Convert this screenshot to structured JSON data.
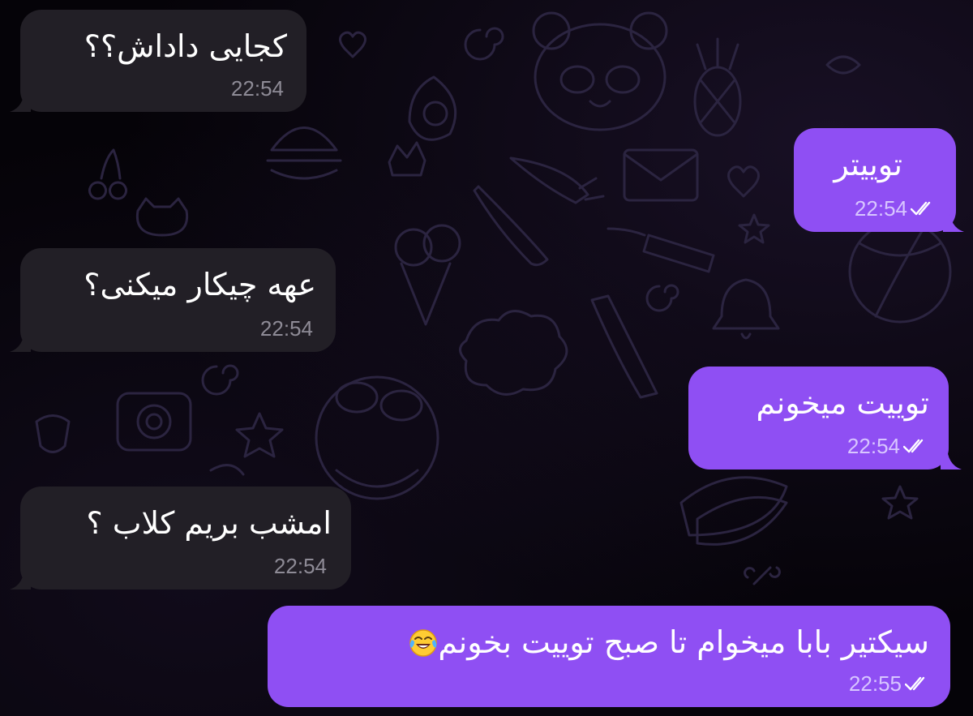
{
  "colors": {
    "background": "#000000",
    "incoming_bubble": "#221f26",
    "outgoing_bubble": "#8f4ff3",
    "incoming_time": "#8e8b96",
    "outgoing_time": "#d8c6ff"
  },
  "messages": [
    {
      "direction": "incoming",
      "text": "کجایی داداش؟؟",
      "time": "22:54"
    },
    {
      "direction": "outgoing",
      "text": "توییتر",
      "time": "22:54",
      "status": "read-double-check-icon"
    },
    {
      "direction": "incoming",
      "text": "عهه چیکار میکنی؟",
      "time": "22:54"
    },
    {
      "direction": "outgoing",
      "text": "توییت میخونم",
      "time": "22:54",
      "status": "read-double-check-icon"
    },
    {
      "direction": "incoming",
      "text": "امشب بریم کلاب ؟",
      "time": "22:54"
    },
    {
      "direction": "outgoing",
      "text": "سیکتیر بابا میخوام تا صبح توییت بخونم",
      "emoji": "laughing-tears-emoji",
      "time": "22:55",
      "status": "read-double-check-icon"
    }
  ]
}
